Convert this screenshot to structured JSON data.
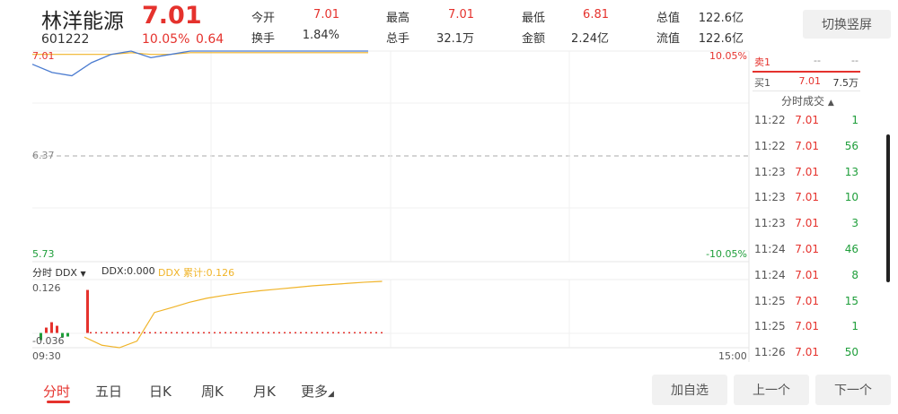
{
  "stock": {
    "name": "林洋能源",
    "price": "7.01",
    "code": "601222",
    "change_pct": "10.05%",
    "change_amt": "0.64"
  },
  "stats": [
    {
      "label": "今开",
      "value": "7.01",
      "color": "#e5322d"
    },
    {
      "label": "换手",
      "value": "1.84%",
      "color": "#333333"
    },
    {
      "label": "最高",
      "value": "7.01",
      "color": "#e5322d"
    },
    {
      "label": "总手",
      "value": "32.1万",
      "color": "#333333"
    },
    {
      "label": "最低",
      "value": "6.81",
      "color": "#e5322d"
    },
    {
      "label": "金额",
      "value": "2.24亿",
      "color": "#333333"
    },
    {
      "label": "总值",
      "value": "122.6亿",
      "color": "#333333"
    },
    {
      "label": "流值",
      "value": "122.6亿",
      "color": "#333333"
    }
  ],
  "switch_button": "切换竖屏",
  "chart_data": {
    "type": "line",
    "price_axis": {
      "top": "7.01",
      "mid": "6.37",
      "bottom": "5.73",
      "top_pct": "10.05%",
      "bottom_pct": "-10.05%"
    },
    "time_axis": {
      "start": "09:30",
      "end": "15:00"
    },
    "indicator": {
      "selector_label": "分时 DDX",
      "ddx_label": "DDX:0.000",
      "ddx_cum_label": "DDX 累计:0.126",
      "top": "0.126",
      "bottom": "-0.036"
    },
    "price_line": [
      6.93,
      6.88,
      6.86,
      6.94,
      6.99,
      7.01,
      6.97,
      6.99,
      7.01,
      7.01,
      7.01,
      7.01,
      7.01,
      7.01,
      7.01,
      7.01,
      7.01,
      7.01
    ],
    "ddx_cumulative": [
      -0.01,
      -0.03,
      -0.036,
      -0.02,
      0.05,
      0.062,
      0.075,
      0.085,
      0.092,
      0.098,
      0.103,
      0.107,
      0.111,
      0.115,
      0.118,
      0.121,
      0.124,
      0.126
    ],
    "colors": {
      "up": "#e5322d",
      "down": "#1e9e3a",
      "avg": "#f0b429",
      "price": "#4a7bd0"
    }
  },
  "order_book": {
    "sell": {
      "label": "卖1",
      "price": "--",
      "vol": "--"
    },
    "buy": {
      "label": "买1",
      "price": "7.01",
      "vol": "7.5万"
    }
  },
  "ticks_title": "分时成交",
  "ticks": [
    {
      "time": "11:22",
      "price": "7.01",
      "vol": "1"
    },
    {
      "time": "11:22",
      "price": "7.01",
      "vol": "56"
    },
    {
      "time": "11:23",
      "price": "7.01",
      "vol": "13"
    },
    {
      "time": "11:23",
      "price": "7.01",
      "vol": "10"
    },
    {
      "time": "11:23",
      "price": "7.01",
      "vol": "3"
    },
    {
      "time": "11:24",
      "price": "7.01",
      "vol": "46"
    },
    {
      "time": "11:24",
      "price": "7.01",
      "vol": "8"
    },
    {
      "time": "11:25",
      "price": "7.01",
      "vol": "15"
    },
    {
      "time": "11:25",
      "price": "7.01",
      "vol": "1"
    },
    {
      "time": "11:26",
      "price": "7.01",
      "vol": "50"
    }
  ],
  "tabs": [
    "分时",
    "五日",
    "日K",
    "周K",
    "月K",
    "更多"
  ],
  "bottom_buttons": {
    "add": "加自选",
    "prev": "上一个",
    "next": "下一个"
  }
}
